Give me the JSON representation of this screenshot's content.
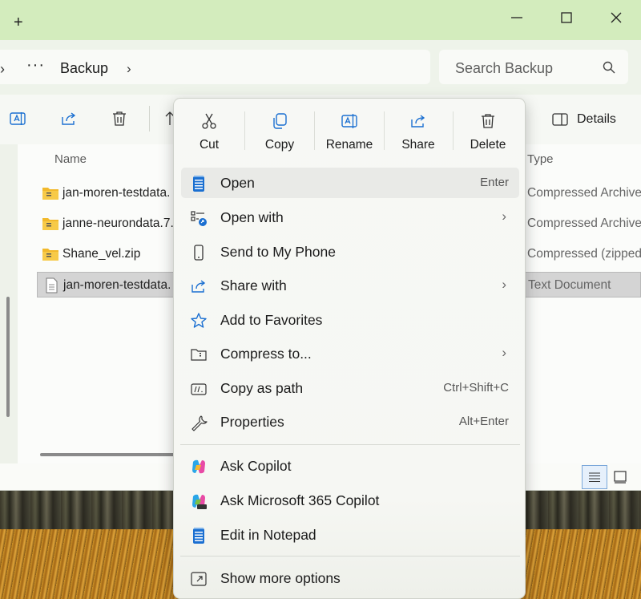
{
  "titlebar": {
    "new_tab": "+"
  },
  "address": {
    "overflow": "···",
    "crumb": "Backup",
    "chevron": "›",
    "back_chevron": "›"
  },
  "search": {
    "placeholder": "Search Backup"
  },
  "toolbar": {
    "details_label": "Details"
  },
  "file_list": {
    "col_name": "Name",
    "col_type": "Type",
    "rows": [
      {
        "name": "jan-moren-testdata.",
        "type": "Compressed Archive"
      },
      {
        "name": "janne-neurondata.7.",
        "type": "Compressed Archive"
      },
      {
        "name": "Shane_vel.zip",
        "type": "Compressed (zipped"
      },
      {
        "name": "jan-moren-testdata.",
        "type": "Text Document"
      }
    ]
  },
  "menu": {
    "quick_actions": [
      {
        "label": "Cut",
        "icon": "cut-icon"
      },
      {
        "label": "Copy",
        "icon": "copy-icon"
      },
      {
        "label": "Rename",
        "icon": "rename-icon"
      },
      {
        "label": "Share",
        "icon": "share-icon"
      },
      {
        "label": "Delete",
        "icon": "delete-icon"
      }
    ],
    "items": [
      {
        "label": "Open",
        "shortcut": "Enter"
      },
      {
        "label": "Open with",
        "submenu": "›"
      },
      {
        "label": "Send to My Phone"
      },
      {
        "label": "Share with",
        "submenu": "›"
      },
      {
        "label": "Add to Favorites"
      },
      {
        "label": "Compress to...",
        "submenu": "›"
      },
      {
        "label": "Copy as path",
        "shortcut": "Ctrl+Shift+C"
      },
      {
        "label": "Properties",
        "shortcut": "Alt+Enter"
      },
      {
        "label": "Ask Copilot"
      },
      {
        "label": "Ask Microsoft 365 Copilot"
      },
      {
        "label": "Edit in Notepad"
      },
      {
        "label": "Show more options"
      }
    ]
  },
  "colors": {
    "titlebar": "#d3ecbd",
    "accent": "#1a6fd1",
    "folder_zip": "#f2b92b"
  }
}
